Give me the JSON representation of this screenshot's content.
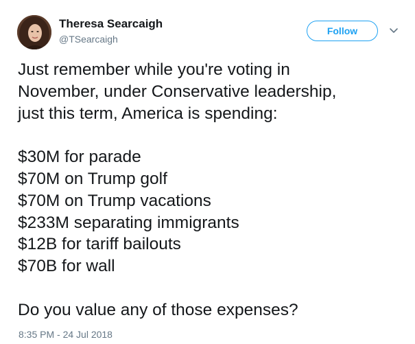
{
  "author": {
    "name": "Theresa Searcaigh",
    "handle": "@TSearcaigh"
  },
  "follow_button": {
    "label": "Follow"
  },
  "menu": {
    "icon": "chevron-down-icon"
  },
  "tweet": {
    "lines": [
      "Just remember while you're voting in",
      "November, under Conservative leadership,",
      "just this term, America is spending:",
      "",
      "$30M for parade",
      "$70M on Trump golf",
      "$70M on Trump vacations",
      "$233M separating immigrants",
      "$12B for tariff bailouts",
      "$70B for wall",
      "",
      "Do you value any of those expenses?"
    ],
    "timestamp": "8:35 PM - 24 Jul 2018"
  },
  "colors": {
    "text": "#14171a",
    "secondary": "#657786",
    "accent": "#1da1f2"
  }
}
